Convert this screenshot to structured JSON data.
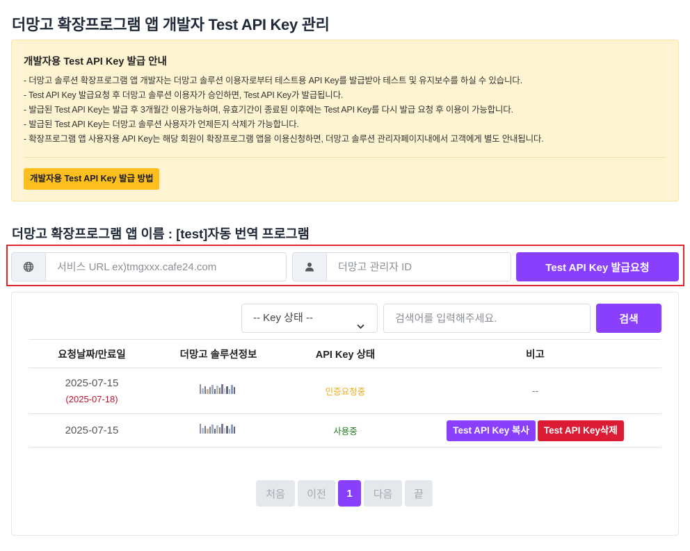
{
  "page": {
    "title": "더망고 확장프로그램 앱 개발자 Test API Key 관리"
  },
  "notice": {
    "title": "개발자용 Test API Key 발급 안내",
    "lines": [
      "- 더망고 솔루션 확장프로그램 앱 개발자는 더망고 솔루션 이용자로부터 테스트용 API Key를 발급받아 테스트 및 유지보수를 하실 수 있습니다.",
      "- Test API Key 발급요청 후 더망고 솔루션 이용자가 승인하면, Test API Key가 발급됩니다.",
      "- 발급된 Test API Key는 발급 후 3개월간 이용가능하며, 유효기간이 종료된 이후에는 Test API Key를 다시 발급 요청 후 이용이 가능합니다.",
      "- 발급된 Test API Key는 더망고 솔루션 사용자가 언제든지 삭제가 가능합니다.",
      "- 확장프로그램 앱 사용자용 API Key는 해당 회원이 확장프로그램 앱을 이용신청하면, 더망고 솔루션 관리자페이지내에서 고객에게 별도 안내됩니다."
    ],
    "button_label": "개발자용 Test API Key 발급 방법"
  },
  "app": {
    "name_label": "더망고 확장프로그램 앱 이름 : [test]자동 번역 프로그램"
  },
  "request": {
    "url_placeholder": "서비스 URL ex)tmgxxx.cafe24.com",
    "url_icon": "globe-icon",
    "id_placeholder": "더망고 관리자 ID",
    "id_icon": "user-icon",
    "button_label": "Test API Key 발급요청"
  },
  "filter": {
    "status_selected": "-- Key 상태 --",
    "search_placeholder": "검색어를 입력해주세요.",
    "search_button": "검색"
  },
  "table": {
    "headers": [
      "요청날짜/만료일",
      "더망고 솔루션정보",
      "API Key 상태",
      "비고"
    ],
    "rows": [
      {
        "date": "2025-07-15",
        "expire": "(2025-07-18)",
        "status": "인증요청중",
        "note": "--"
      },
      {
        "date": "2025-07-15",
        "status": "사용중",
        "copy_label": "Test API Key 복사",
        "delete_label": "Test API Key삭제"
      }
    ]
  },
  "pagination": {
    "first": "처음",
    "prev": "이전",
    "current": "1",
    "next": "다음",
    "last": "끝"
  },
  "colors": {
    "accent": "#8a3ffc",
    "danger": "#dc1c35",
    "notice_bg": "#fff4d1",
    "notice_button": "#fcbf1e",
    "pending": "#f0ad1e",
    "active": "#1d7a1d"
  }
}
